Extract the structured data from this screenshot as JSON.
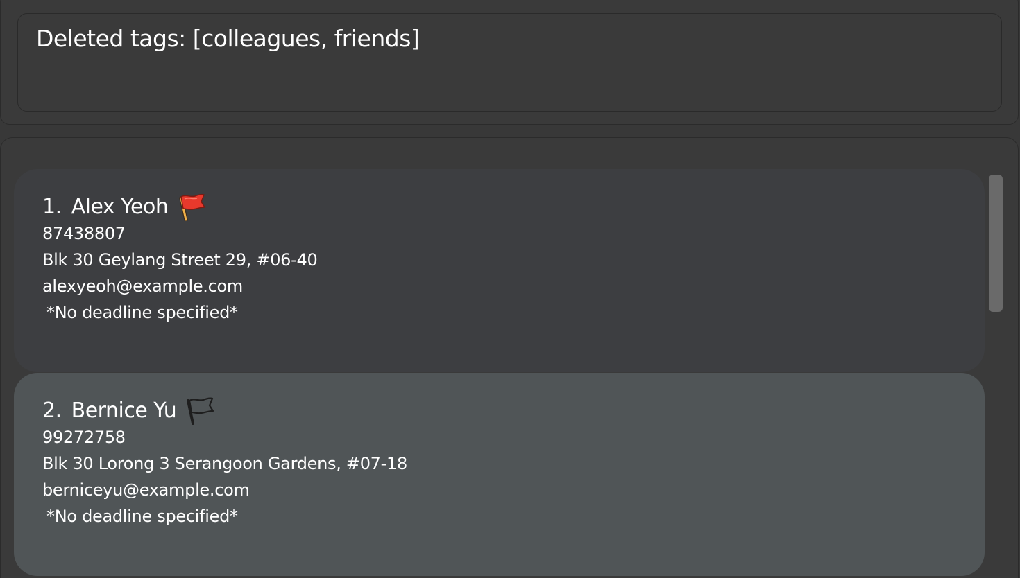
{
  "result": {
    "message": "Deleted tags: [colleagues, friends]"
  },
  "persons": [
    {
      "index": "1.",
      "name": "Alex Yeoh",
      "flag_icon": "red-flag-icon",
      "flag_color": "#e8392c",
      "phone": "87438807",
      "address": "Blk 30 Geylang Street 29, #06-40",
      "email": "alexyeoh@example.com",
      "deadline": "*No deadline specified*"
    },
    {
      "index": "2.",
      "name": "Bernice Yu",
      "flag_icon": "white-flag-icon",
      "flag_color": "#505557",
      "phone": "99272758",
      "address": "Blk 30 Lorong 3 Serangoon Gardens, #07-18",
      "email": "berniceyu@example.com",
      "deadline": "*No deadline specified*"
    }
  ],
  "colors": {
    "background": "#383838",
    "card_default": "#3d3e41",
    "card_selected": "#505557",
    "text": "#ffffff",
    "scrollbar_thumb": "#6a6a6a"
  }
}
